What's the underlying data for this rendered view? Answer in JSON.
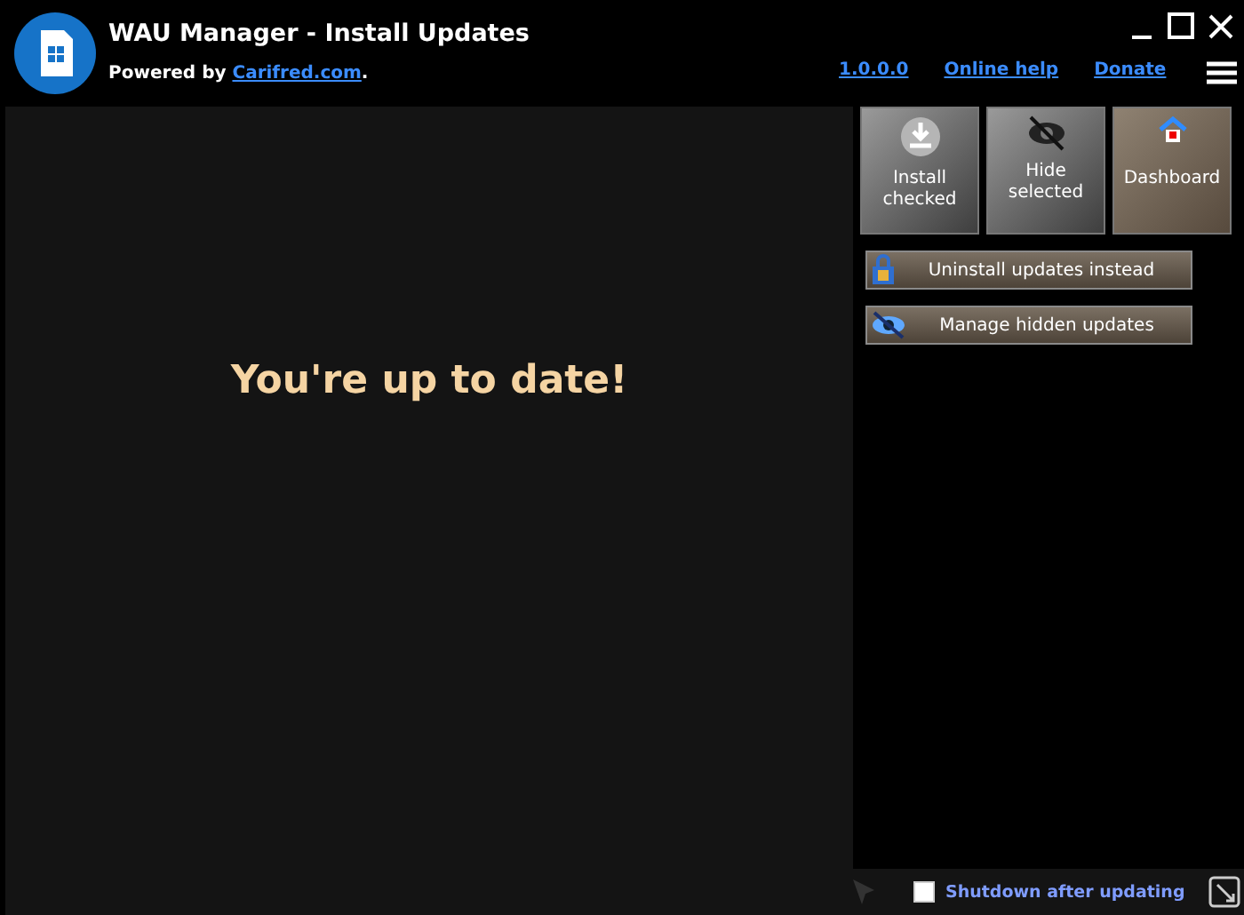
{
  "window": {
    "title": "WAU Manager - Install Updates"
  },
  "powered_by": {
    "prefix": "Powered by",
    "link": "Carifred.com",
    "suffix": "."
  },
  "header_links": [
    "1.0.0.0",
    "Online help",
    "Donate"
  ],
  "action_buttons": [
    {
      "kind": "install",
      "label": "Install checked"
    },
    {
      "kind": "hide",
      "label": "Hide selected"
    },
    {
      "kind": "dashboard",
      "label": "Dashboard"
    }
  ],
  "wide_buttons": [
    {
      "kind": "uninstall",
      "label": "Uninstall updates instead"
    },
    {
      "kind": "hidden",
      "label": "Manage hidden updates"
    }
  ],
  "message": "You're up to date!",
  "shutdown": {
    "label": "Shutdown after updating",
    "checked": false
  }
}
